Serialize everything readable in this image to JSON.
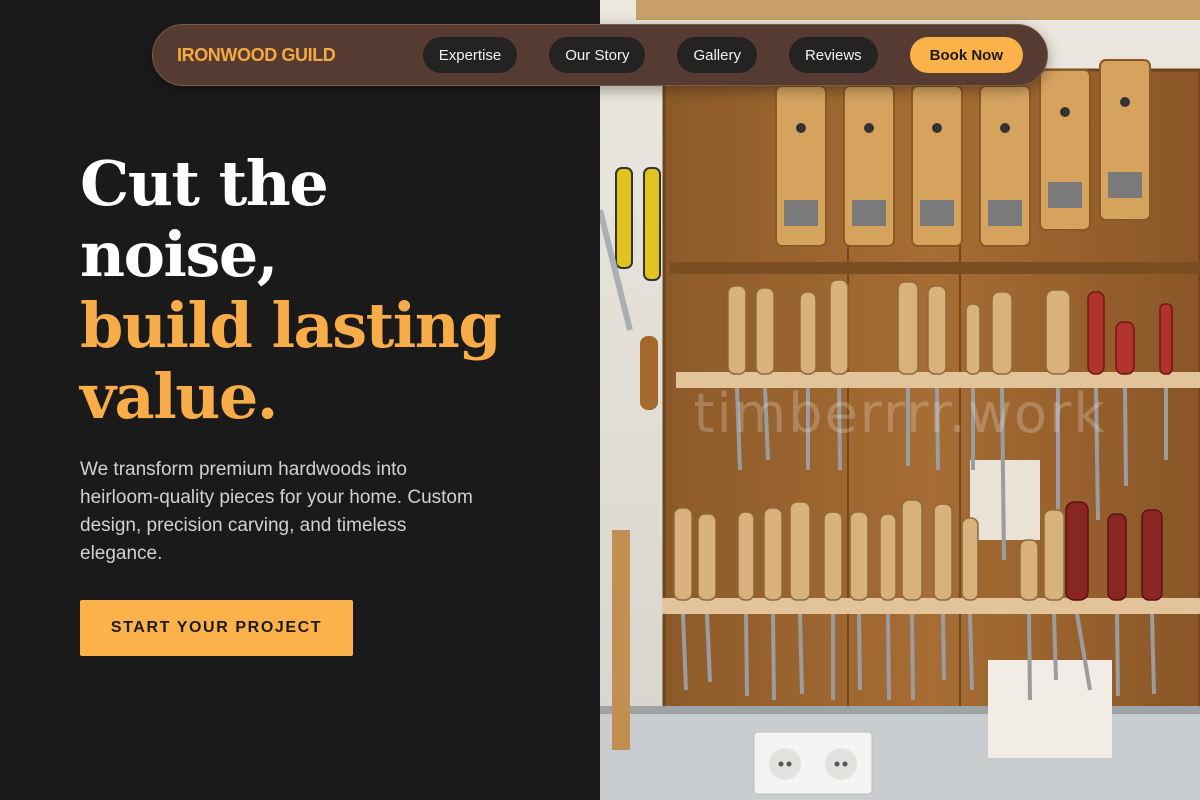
{
  "brand": {
    "name": "IRONWOOD GUILD"
  },
  "nav": {
    "links": [
      "Expertise",
      "Our Story",
      "Gallery",
      "Reviews"
    ],
    "cta": "Book Now"
  },
  "hero": {
    "headline_line1": "Cut the",
    "headline_line2": "noise,",
    "headline_line3": "build lasting",
    "headline_line4": "value.",
    "description": "We transform premium hardwoods into heirloom-quality pieces for your home. Custom design, precision carving, and timeless elegance.",
    "cta": "START YOUR PROJECT"
  },
  "image": {
    "subject": "woodworking tool wall with hand planes and chisels",
    "watermark": "timberrrr.work"
  },
  "colors": {
    "background": "#1b1a1a",
    "accent": "#fbb24a",
    "nav_bg": "#553b32",
    "pill_bg": "#242222"
  }
}
